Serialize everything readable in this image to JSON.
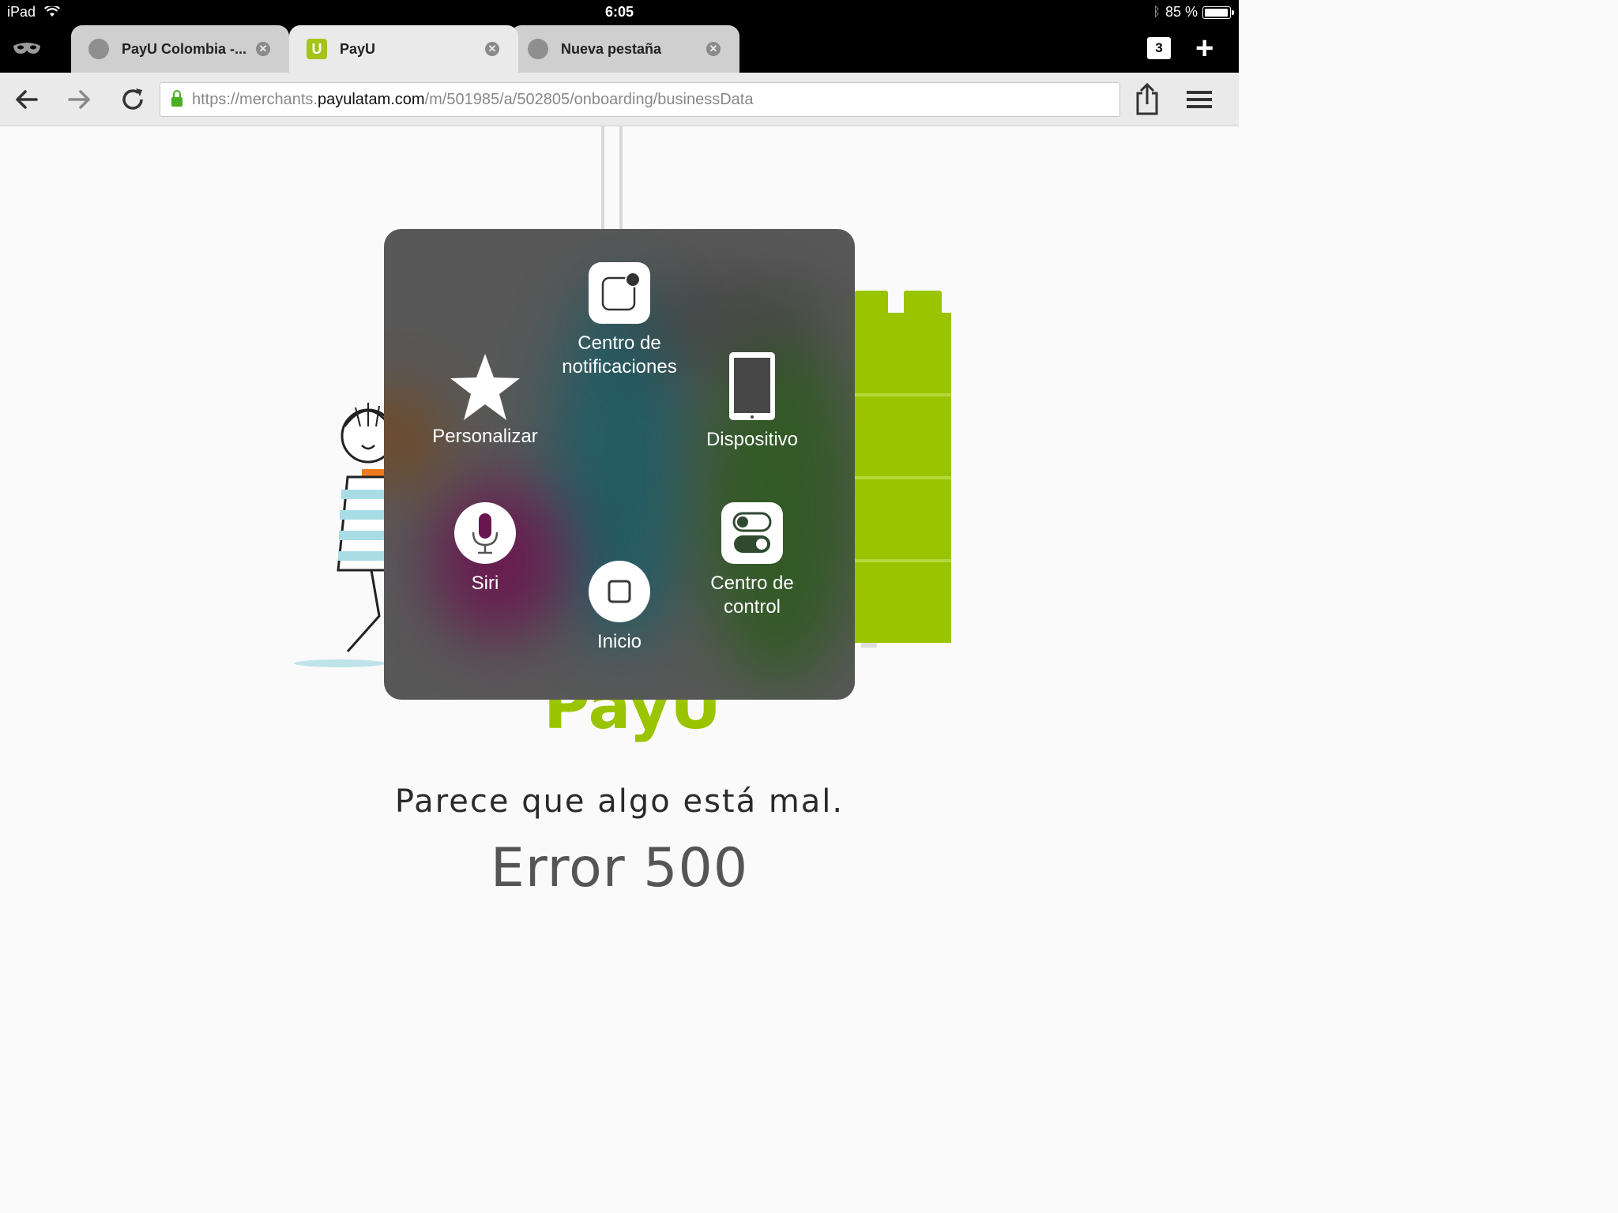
{
  "status": {
    "device": "iPad",
    "time": "6:05",
    "battery": "85 %"
  },
  "tabs": [
    {
      "title": "PayU Colombia -...",
      "icon": "globe-icon",
      "active": false
    },
    {
      "title": "PayU",
      "icon": "payu-favicon",
      "active": true
    },
    {
      "title": "Nueva pestaña",
      "icon": "globe-icon",
      "active": false
    }
  ],
  "tab_count": "3",
  "url": {
    "prefix": "https://merchants.",
    "domain": "payulatam.com",
    "path": "/m/501985/a/502805/onboarding/businessData"
  },
  "page": {
    "logo": "PayU",
    "heading": "Parece que algo está mal.",
    "error": "Error 500"
  },
  "assistive_touch": {
    "notifications": "Centro de\nnotificaciones",
    "customize": "Personalizar",
    "device": "Dispositivo",
    "siri": "Siri",
    "home": "Inicio",
    "control": "Centro de\ncontrol"
  },
  "colors": {
    "brand_green": "#9bc400",
    "overlay": "#585858"
  }
}
